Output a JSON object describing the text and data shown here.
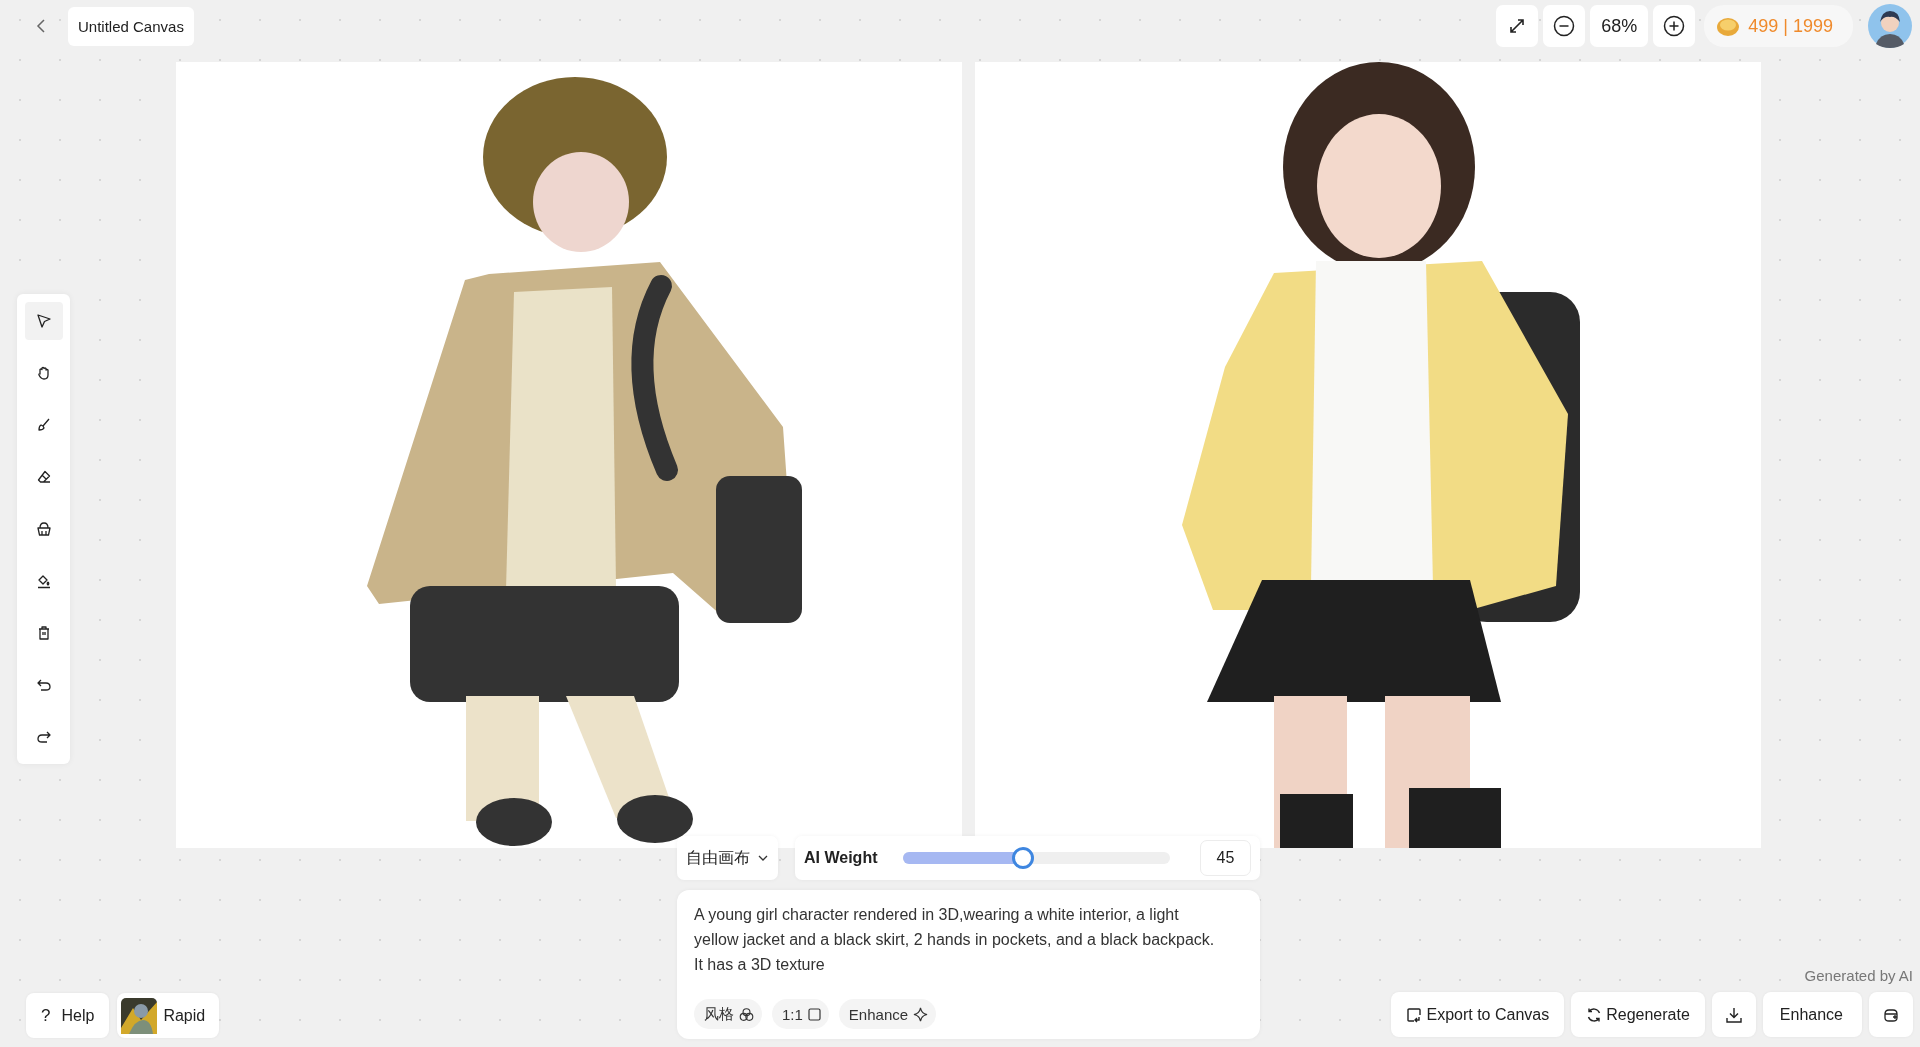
{
  "header": {
    "title": "Untitled Canvas",
    "zoom": "68%",
    "credits": "499 | 1999"
  },
  "tools": [
    {
      "kind": "select",
      "selected": true
    },
    {
      "kind": "hand",
      "selected": false
    },
    {
      "kind": "brush",
      "selected": false
    },
    {
      "kind": "eraser",
      "selected": false
    },
    {
      "kind": "basket",
      "selected": false
    },
    {
      "kind": "fill",
      "selected": false
    },
    {
      "kind": "trash",
      "selected": false
    },
    {
      "kind": "undo",
      "selected": false
    },
    {
      "kind": "redo",
      "selected": false
    }
  ],
  "mode": {
    "label": "自由画布"
  },
  "ai_weight": {
    "label": "AI Weight",
    "level": 0.45,
    "value": "45"
  },
  "prompt": {
    "text": "A young girl character rendered in 3D,wearing a white interior, a light yellow jacket and a black skirt, 2 hands in pockets, and a black backpack. It has a 3D texture",
    "chips": [
      {
        "kind": "style",
        "label": "风格"
      },
      {
        "kind": "ratio",
        "label": "1:1"
      },
      {
        "kind": "enhance",
        "label": "Enhance"
      }
    ]
  },
  "help": {
    "icon": "?",
    "label": "Help"
  },
  "model": {
    "label": "Rapid"
  },
  "note": "Generated by AI",
  "actions": [
    {
      "kind": "export",
      "label": "Export to Canvas"
    },
    {
      "kind": "regenerate",
      "label": "Regenerate"
    },
    {
      "kind": "download"
    },
    {
      "kind": "enhance",
      "label": "Enhance"
    },
    {
      "kind": "save"
    }
  ]
}
